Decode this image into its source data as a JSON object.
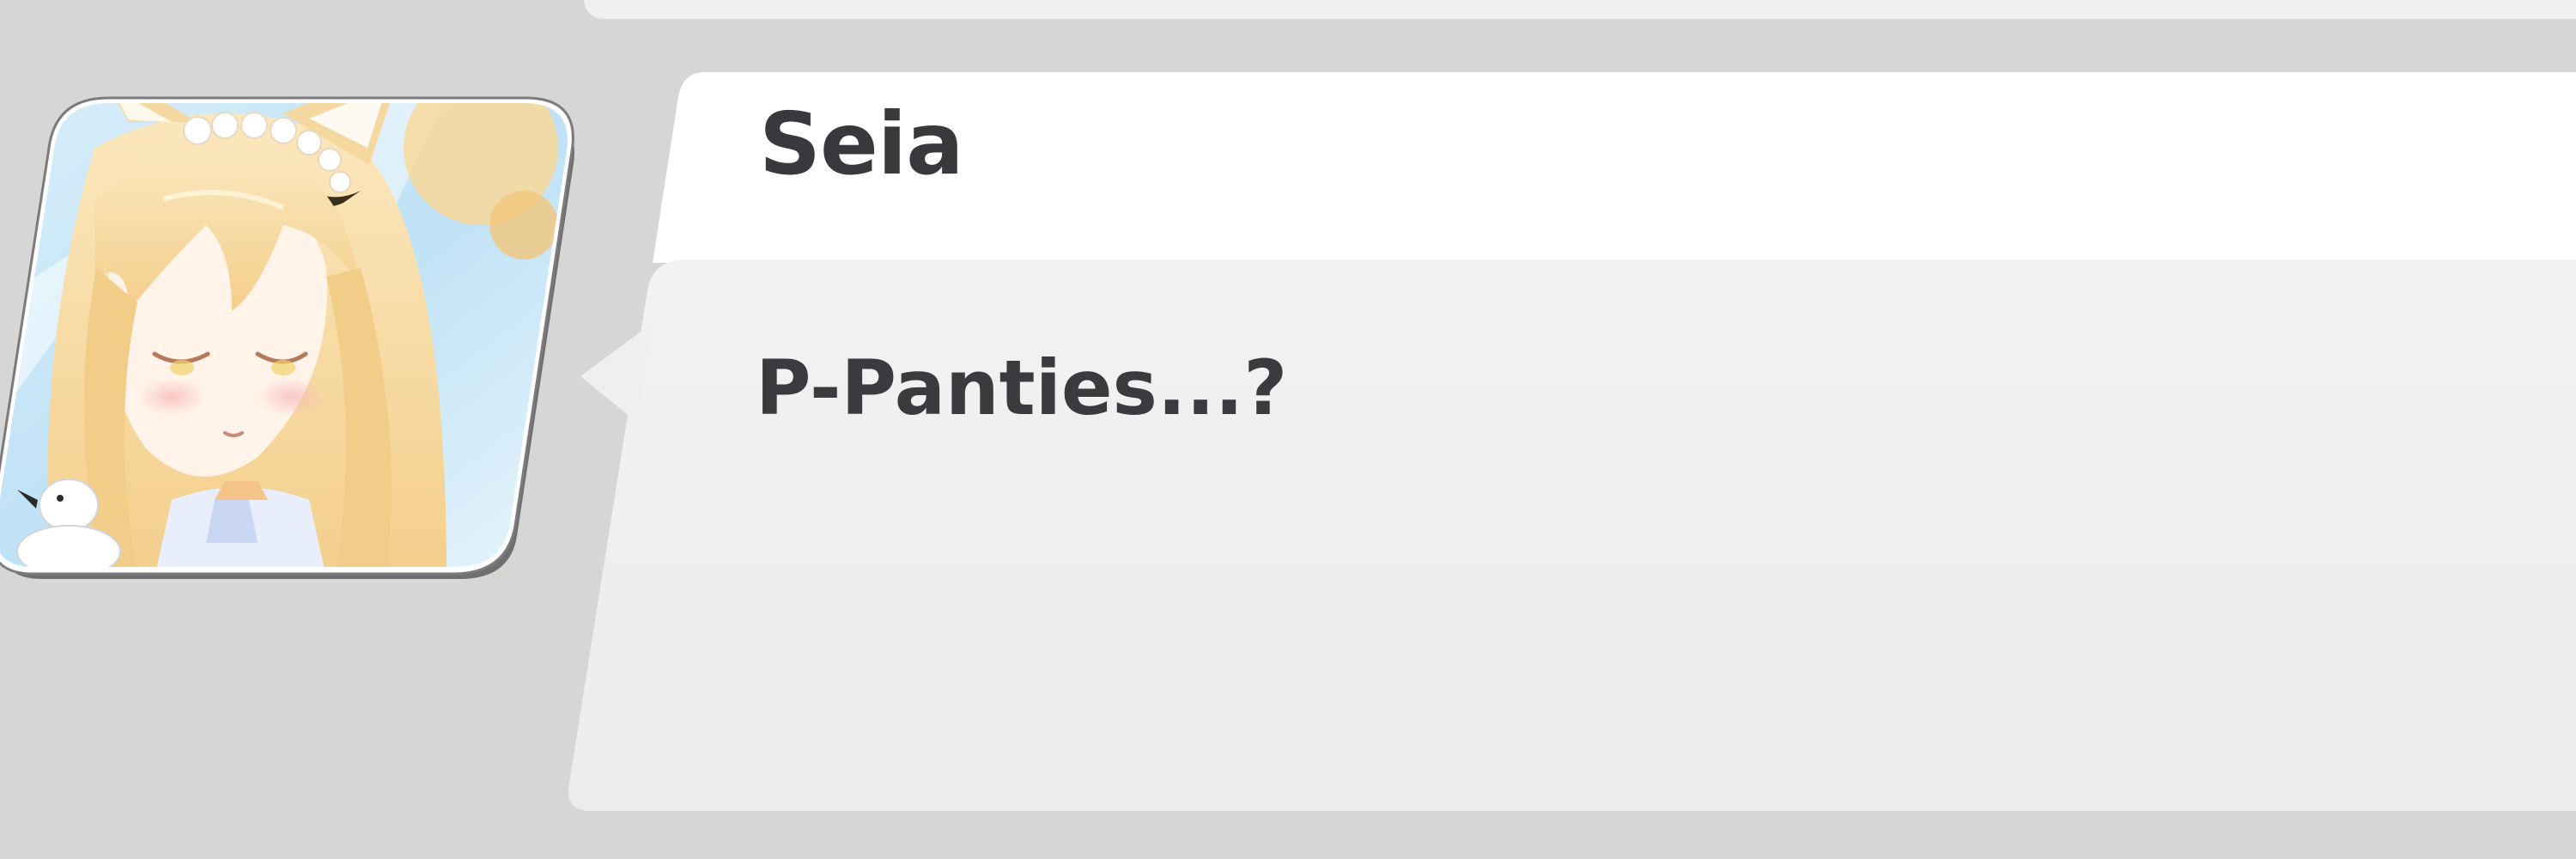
{
  "dialogue": {
    "speaker_name": "Seia",
    "text": "P-Panties...?"
  },
  "portrait": {
    "icon": "seia-portrait",
    "alt": ""
  },
  "colors": {
    "background": "#d6d6d4",
    "name_panel": "#ffffff",
    "text_panel": "#efefef",
    "name_text": "#38393d",
    "body_text": "#3a3b3f"
  }
}
